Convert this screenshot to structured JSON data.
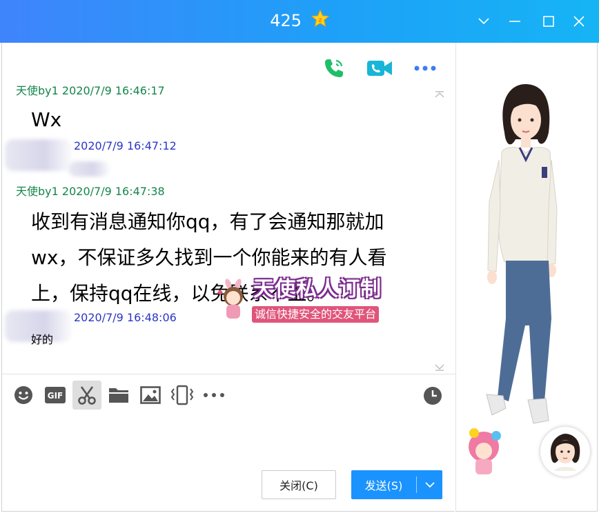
{
  "window": {
    "title": "425",
    "title_icon": "vip-star-icon",
    "controls": [
      "dropdown-icon",
      "minimize-icon",
      "maximize-icon",
      "close-icon"
    ]
  },
  "top_actions": [
    "voice-call-icon",
    "video-call-icon",
    "more-icon"
  ],
  "messages": [
    {
      "sender": "天使by1",
      "time": "2020/7/9 16:46:17",
      "text": "Wx",
      "style": "large",
      "sender_color": "#14854a"
    },
    {
      "sender": "",
      "time": "2020/7/9 16:47:12",
      "text": "",
      "style": "small",
      "sender_color": "#2b35c6"
    },
    {
      "sender": "天使by1",
      "time": "2020/7/9 16:47:38",
      "text_lines": [
        "收到有消息通知你qq，有了会通知那就加",
        "wx，不保证多久找到一个你能来的有人看",
        "上，保持qq在线，以免联系不上。"
      ],
      "style": "large",
      "sender_color": "#14854a"
    },
    {
      "sender": "",
      "time": "2020/7/9 16:48:06",
      "text": "好的",
      "style": "small",
      "sender_color": "#2b35c6"
    }
  ],
  "toolbar": [
    "emoji-icon",
    "gif-icon",
    "screenshot-scissors-icon",
    "folder-icon",
    "image-icon",
    "shake-icon",
    "more-icon"
  ],
  "history_icon": "clock-icon",
  "buttons": {
    "close": "关闭(C)",
    "send": "发送(S)"
  },
  "watermark": {
    "title": "天使私人订制",
    "subtitle": "诚信快捷安全的交友平台"
  },
  "colors": {
    "titlebar_start": "#3f84fb",
    "titlebar_end": "#16b4f5",
    "send_button": "#1a93ff",
    "call_green": "#1fbf6a",
    "video_teal": "#19b5d8",
    "more_blue": "#3d7cf5"
  }
}
